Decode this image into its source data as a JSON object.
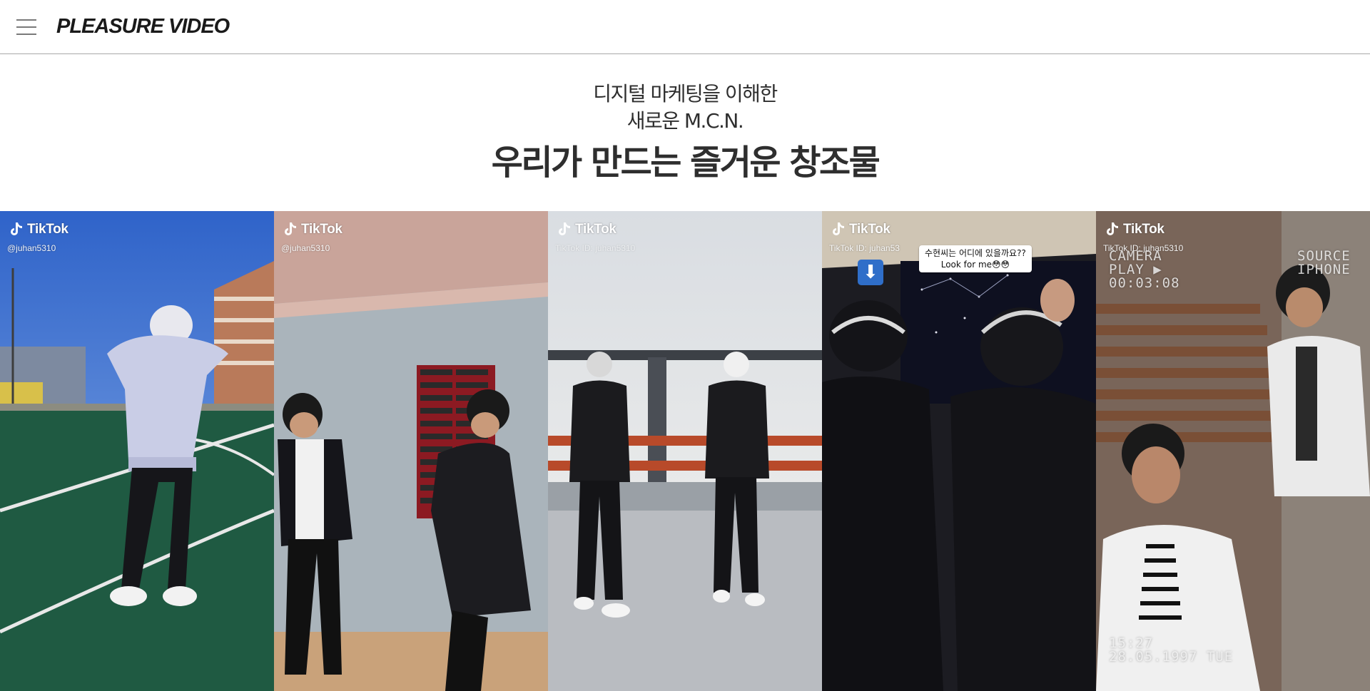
{
  "header": {
    "logo": "PLEASURE VIDEO"
  },
  "hero": {
    "line1": "디지털 마케팅을 이해한",
    "line2": "새로운 M.C.N.",
    "headline": "우리가 만드는 즐거운 창조물"
  },
  "gallery": {
    "tiles": [
      {
        "brand": "TikTok",
        "handle": "@juhan5310"
      },
      {
        "brand": "TikTok",
        "handle": "@juhan5310"
      },
      {
        "brand": "TikTok",
        "handle": "TikTok ID: juhan5310"
      },
      {
        "brand": "TikTok",
        "handle": "TikTok ID: juhan53",
        "caption_line1": "수현씨는 어디에 있을까요??",
        "caption_line2": "Look for me😳😳",
        "arrow": "⬇"
      },
      {
        "brand": "TikTok",
        "handle": "TikTok ID: juhan5310",
        "vhs_camera": "CAMERA",
        "vhs_play": "PLAY ▶",
        "vhs_time": "00:03:08",
        "vhs_source": "SOURCE",
        "vhs_device": "IPHONE",
        "vhs_clock": "15:27",
        "vhs_date": "28.05.1997 TUE"
      }
    ]
  },
  "colors": {
    "text": "#2e2e2e",
    "header_border": "#a8a8a8",
    "menu_icon": "#7a7a7a"
  },
  "icons": {
    "menu": "hamburger-menu-icon",
    "tiktok": "tiktok-note-icon"
  }
}
